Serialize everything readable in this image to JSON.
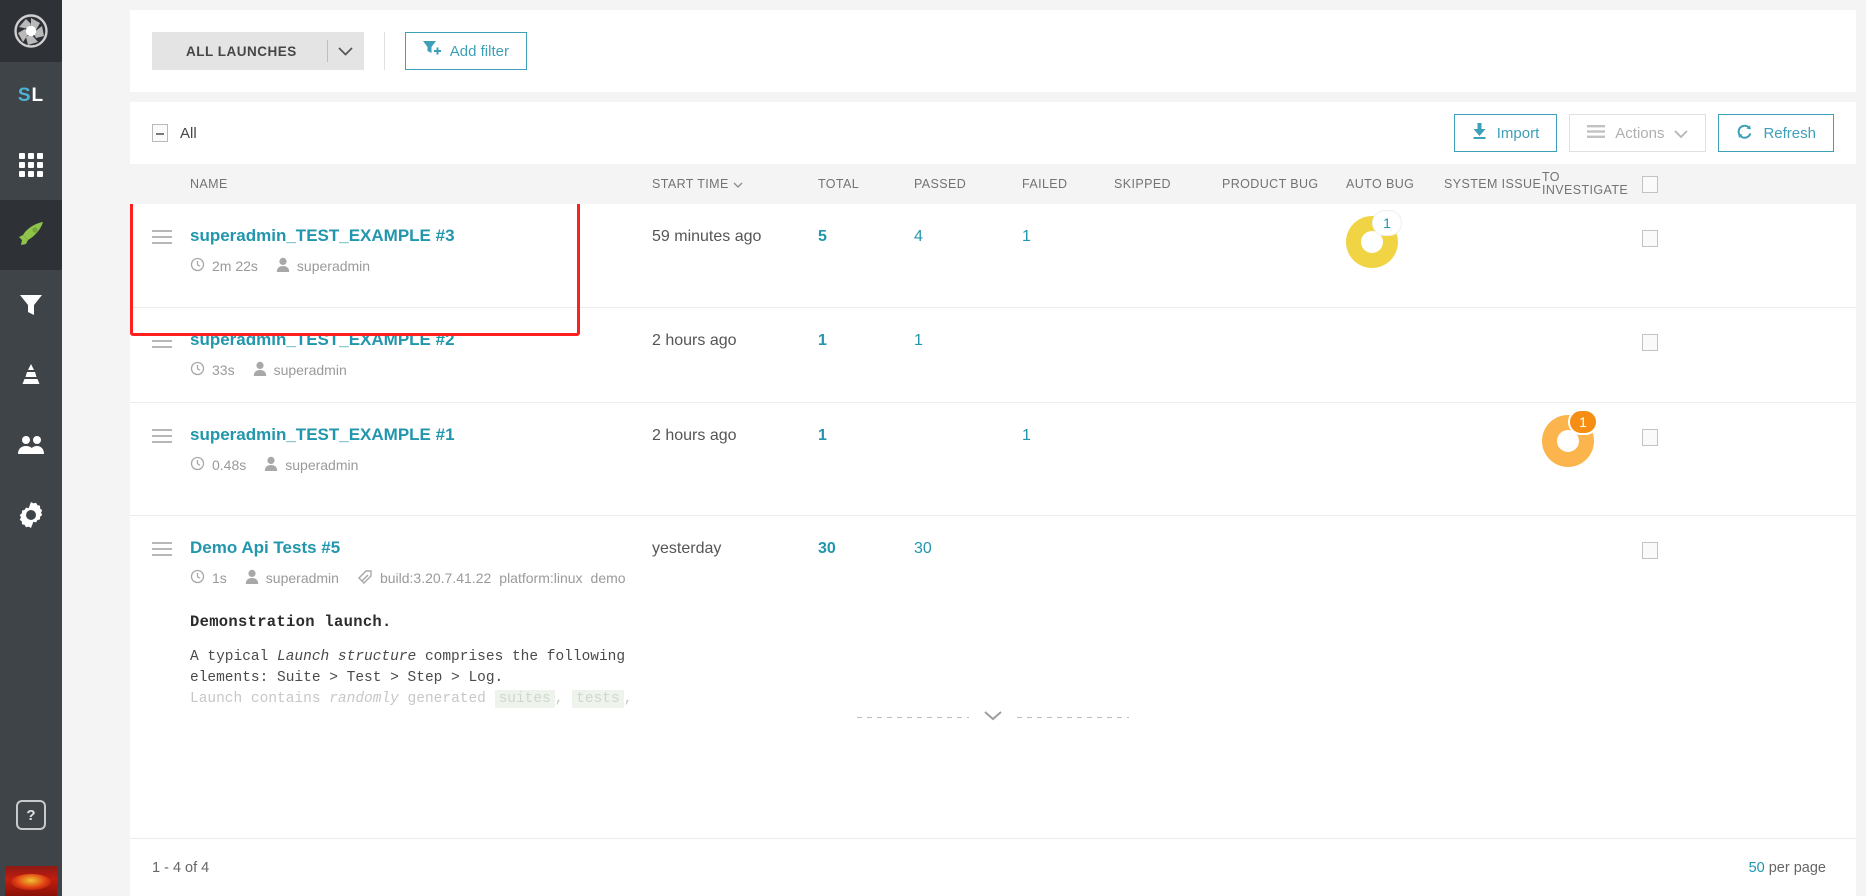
{
  "sidebar": {
    "logo_icon": "aperture-logo-icon",
    "project_short": "SL",
    "project_short_parts": {
      "first": "S",
      "second": "L"
    },
    "items": [
      {
        "name": "dashboards",
        "icon": "grid-icon",
        "active": false
      },
      {
        "name": "launches",
        "icon": "rocket-icon",
        "active": true
      },
      {
        "name": "filters",
        "icon": "funnel-icon",
        "active": false
      },
      {
        "name": "debug",
        "icon": "cone-icon",
        "active": false
      },
      {
        "name": "members",
        "icon": "people-icon",
        "active": false
      },
      {
        "name": "settings",
        "icon": "gear-icon",
        "active": false
      }
    ],
    "help_label": "?",
    "avatar_icon": "user-avatar"
  },
  "filter_bar": {
    "all_launches_label": "ALL LAUNCHES",
    "dropdown_icon": "chevron-down-icon",
    "add_filter_label": "Add filter",
    "add_filter_icon": "filter-plus-icon"
  },
  "toolbar": {
    "select_all_label": "All",
    "import_label": "Import",
    "import_icon": "download-icon",
    "actions_label": "Actions",
    "actions_icon": "hamburger-icon",
    "actions_caret_icon": "chevron-down-icon",
    "refresh_label": "Refresh",
    "refresh_icon": "refresh-icon"
  },
  "table": {
    "columns": {
      "name": "NAME",
      "start_time": "START TIME",
      "start_time_sort_icon": "chevron-down-icon",
      "total": "TOTAL",
      "passed": "PASSED",
      "failed": "FAILED",
      "skipped": "SKIPPED",
      "product_bug": "PRODUCT BUG",
      "auto_bug": "AUTO BUG",
      "system_issue": "SYSTEM ISSUE",
      "to_investigate_line1": "TO",
      "to_investigate_line2": "INVESTIGATE"
    },
    "rows": [
      {
        "name": "superadmin_TEST_EXAMPLE #3",
        "duration": "2m 22s",
        "owner": "superadmin",
        "start_time": "59 minutes ago",
        "total": "5",
        "passed": "4",
        "failed": "1",
        "skipped": "",
        "product_bug": "",
        "auto_bug_donut": {
          "count": "1",
          "color": "#f0d444",
          "badge_style": "outline",
          "badge_text_color": "#2196ad"
        },
        "system_issue": "",
        "to_investigate": "",
        "highlighted": true
      },
      {
        "name": "superadmin_TEST_EXAMPLE #2",
        "duration": "33s",
        "owner": "superadmin",
        "start_time": "2 hours ago",
        "total": "1",
        "passed": "1",
        "failed": "",
        "skipped": "",
        "product_bug": "",
        "system_issue": "",
        "to_investigate": "",
        "highlighted": false
      },
      {
        "name": "superadmin_TEST_EXAMPLE #1",
        "duration": "0.48s",
        "owner": "superadmin",
        "start_time": "2 hours ago",
        "total": "1",
        "passed": "",
        "failed": "1",
        "skipped": "",
        "product_bug": "",
        "system_issue": "",
        "to_investigate_donut": {
          "count": "1",
          "color": "#fcb44d",
          "badge_style": "filled",
          "badge_color": "#f58e12",
          "badge_text_color": "#ffffff"
        },
        "highlighted": false
      },
      {
        "name": "Demo Api Tests #5",
        "duration": "1s",
        "owner": "superadmin",
        "build": "build:3.20.7.41.22",
        "tags": [
          "platform:linux",
          "demo"
        ],
        "start_time": "yesterday",
        "total": "30",
        "passed": "30",
        "failed": "",
        "skipped": "",
        "product_bug": "",
        "system_issue": "",
        "to_investigate": "",
        "highlighted": false,
        "description": {
          "title": "Demonstration launch.",
          "line1_a": "A typical ",
          "line1_em": "Launch structure",
          "line1_b": " comprises the following",
          "line2": "elements: Suite > Test > Step > Log.",
          "line3_a": "Launch contains ",
          "line3_em": "randomly",
          "line3_b": " generated ",
          "line3_code1": "suites",
          "line3_sep": ", ",
          "line3_code2": "tests",
          "line3_end": ","
        }
      }
    ],
    "expander_icon": "chevron-down-icon"
  },
  "footer": {
    "range": "1 - 4 of 4",
    "page_size_number": "50",
    "page_size_suffix": " per page"
  },
  "colors": {
    "accent": "#2196ad",
    "link": "#3e9fb8",
    "highlight": "#ff1f1f",
    "auto_bug": "#f0d444",
    "to_investigate": "#fcb44d",
    "sidebar_bg": "#3f4449",
    "rocket_green": "#8fc44a"
  }
}
